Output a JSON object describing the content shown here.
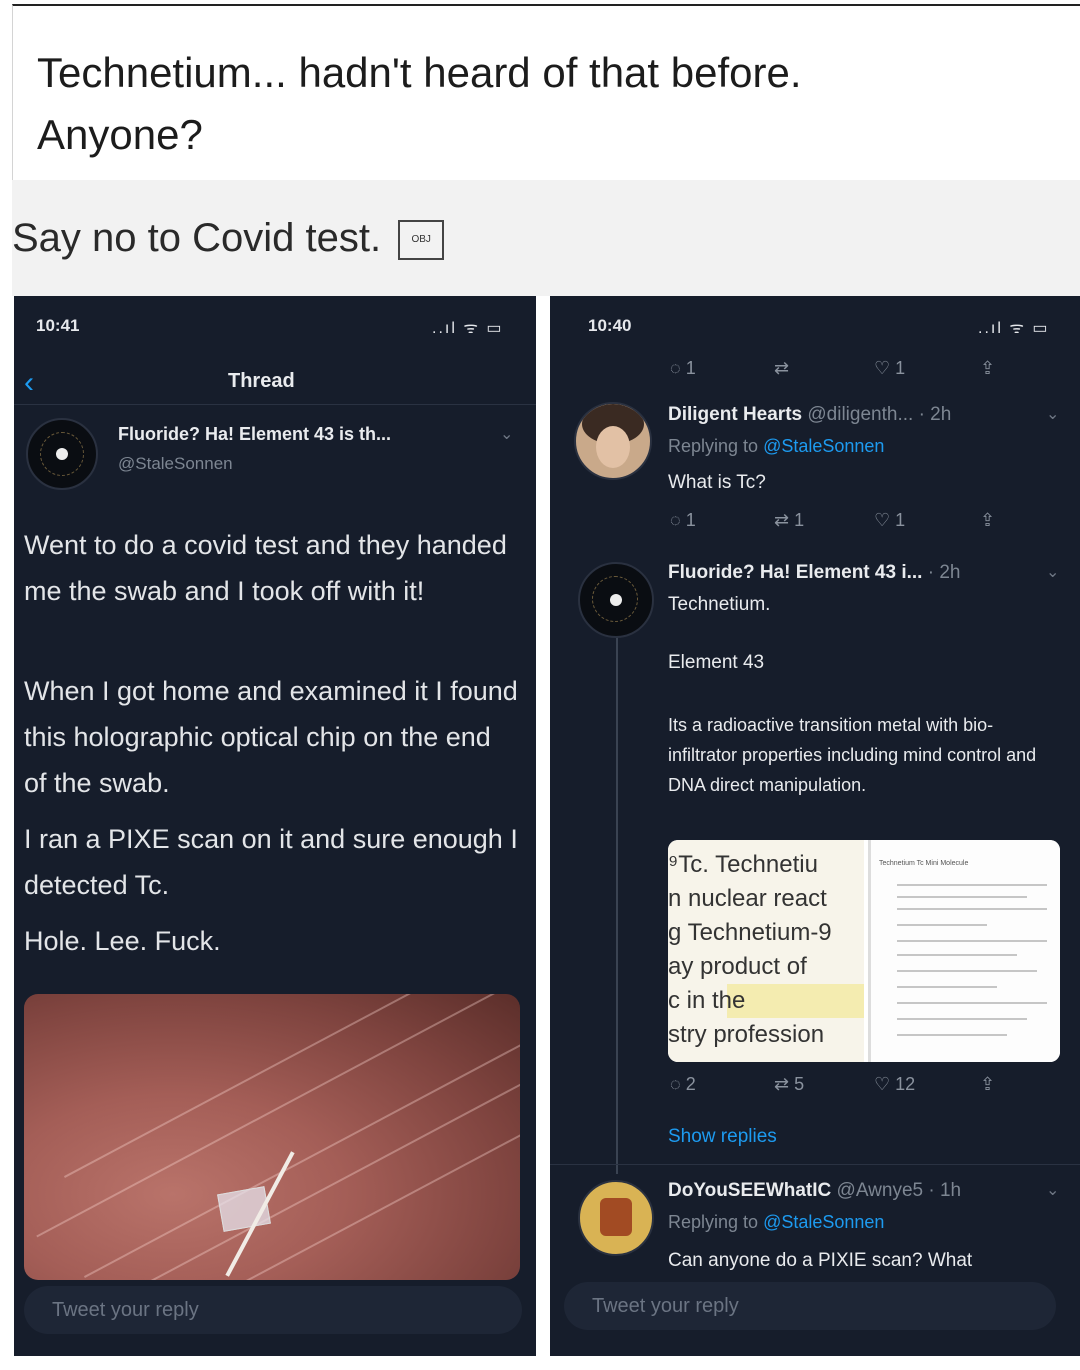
{
  "post": {
    "caption_line1": "Technetium... hadn't heard of that before.",
    "caption_line2": "Anyone?"
  },
  "repost": {
    "text": "Say no to Covid test.",
    "emoji_label": "OBJ"
  },
  "left_phone": {
    "time": "10:41",
    "signal": "..ıl ᯤ ▭",
    "header_title": "Thread",
    "back_icon": "chevron-left-icon",
    "author_name": "Fluoride? Ha! Element 43 is th...",
    "author_handle": "@StaleSonnen",
    "tweet_paragraphs": [
      "Went to do a covid test and they handed me the swab and I took off with it!",
      "When I got home and examined it I found this holographic optical chip on the end of the swab.",
      "I ran a PIXE scan on it and sure enough I detected Tc.",
      "Hole. Lee. Fuck."
    ],
    "reply_placeholder": "Tweet your reply"
  },
  "right_phone": {
    "time": "10:40",
    "signal": "..ıl ᯤ ▭",
    "top_actions": {
      "replies": "1",
      "retweets": "",
      "likes": "1"
    },
    "reply1": {
      "name": "Diligent Hearts",
      "handle": "@diligenth...",
      "time": "· 2h",
      "replying_label": "Replying to",
      "replying_to": "@StaleSonnen",
      "text": "What is Tc?",
      "actions": {
        "replies": "1",
        "retweets": "1",
        "likes": "1"
      }
    },
    "reply2": {
      "name": "Fluoride? Ha! Element 43 i...",
      "time": "· 2h",
      "text1": "Technetium.",
      "text2": "Element 43",
      "text3": "Its a radioactive transition metal with bio-infiltrator properties including mind control and DNA direct manipulation.",
      "actions": {
        "replies": "2",
        "retweets": "5",
        "likes": "12"
      }
    },
    "image_lines": [
      "⁹Tc. Technetiu",
      "n nuclear react",
      "g Technetium-9",
      "ay product of",
      "c in the",
      "stry profession"
    ],
    "image_right_title": "Technetium Tc Mini Molecule",
    "show_replies": "Show replies",
    "reply3": {
      "name": "DoYouSEEWhatIC",
      "handle": "@Awnye5",
      "time": "· 1h",
      "replying_label": "Replying to",
      "replying_to": "@StaleSonnen",
      "text": "Can anyone do a PIXIE scan? What"
    },
    "reply_placeholder": "Tweet your reply"
  }
}
